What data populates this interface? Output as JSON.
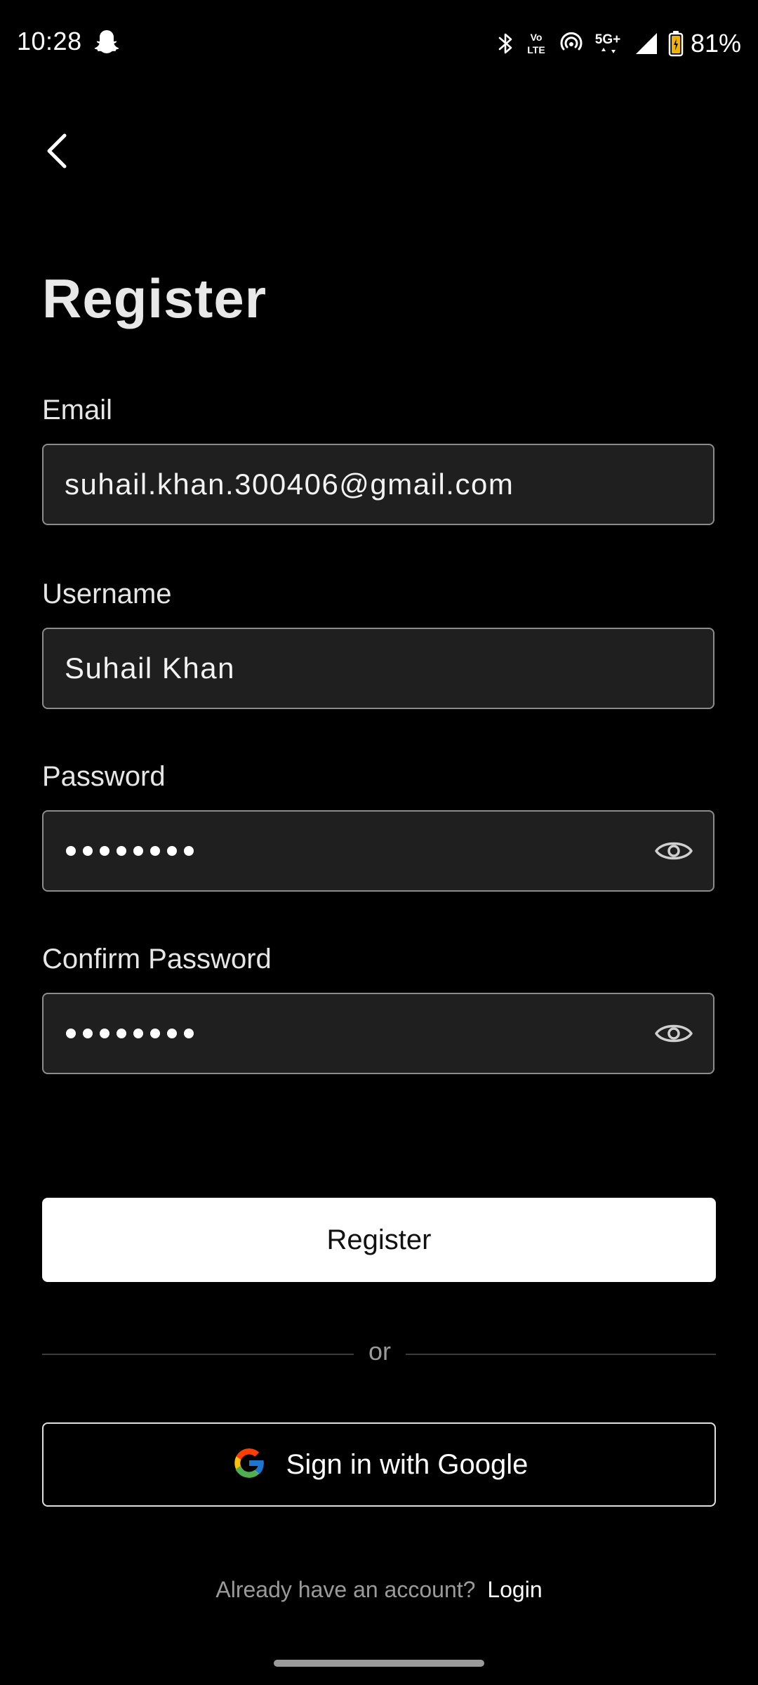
{
  "status_bar": {
    "time": "10:28",
    "network": "5G+",
    "volte": "Vo LTE",
    "battery": "81%",
    "icons": [
      "snapchat-ghost-icon",
      "bluetooth-icon",
      "volte-icon",
      "hotspot-icon",
      "5g-plus-icon",
      "signal-icon",
      "battery-icon"
    ]
  },
  "header": {
    "back_icon": "chevron-left-icon",
    "title": "Register"
  },
  "form": {
    "email": {
      "label": "Email",
      "value": "suhail.khan.300406@gmail.com"
    },
    "username": {
      "label": "Username",
      "value": "Suhail Khan"
    },
    "password": {
      "label": "Password",
      "masked_length": 8,
      "toggle_icon": "eye-icon"
    },
    "confirm_password": {
      "label": "Confirm Password",
      "masked_length": 8,
      "toggle_icon": "eye-icon"
    }
  },
  "actions": {
    "register_label": "Register",
    "divider_text": "or",
    "google_label": "Sign in with Google",
    "google_icon": "google-g-icon"
  },
  "footer": {
    "prompt": "Already have an account?",
    "login_label": "Login"
  },
  "colors": {
    "background": "#000000",
    "field_background": "#1f1f1f",
    "field_border": "#8c8c8c",
    "primary_button": "#ffffff",
    "muted_text": "#9a9a9a"
  }
}
